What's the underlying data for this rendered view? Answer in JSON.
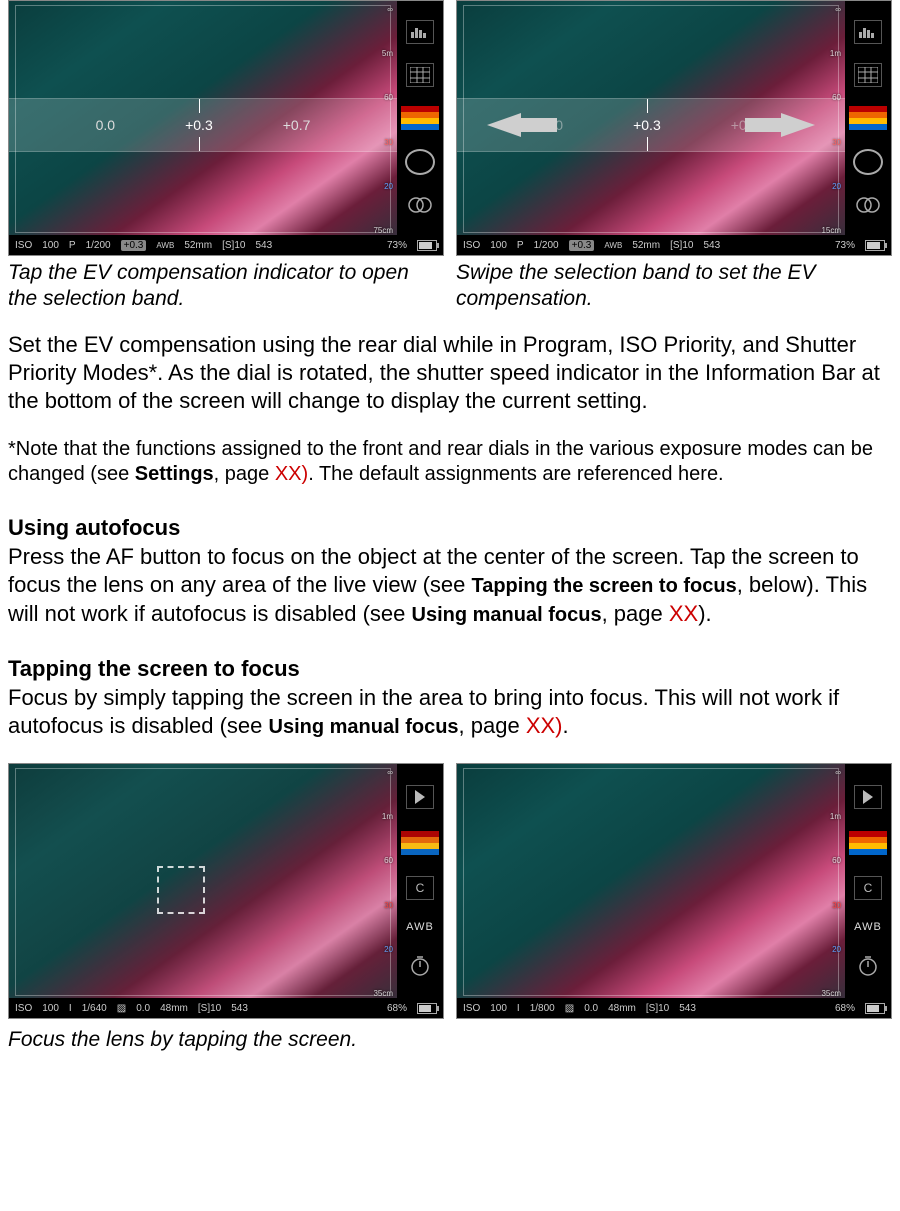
{
  "figures_top": {
    "left_caption": "Tap the EV compensation indicator to open the selection band.",
    "right_caption": "Swipe the selection band to set the EV compensation.",
    "band": {
      "left_value": "0.0",
      "center_value": "+0.3",
      "right_value": "+0.7"
    },
    "info_bar": {
      "iso_label": "ISO",
      "iso": "100",
      "mode": "P",
      "shutter": "1/200",
      "ev_box": "+0.3",
      "wb": "AWB",
      "lens": "52mm",
      "series": "[S]10",
      "frames": "543",
      "battery": "73%"
    },
    "scale": {
      "inf": "∞",
      "m5": "5m",
      "cm60": "60",
      "n30": "30",
      "n20": "20",
      "cm75": "75cm",
      "m1": "1m",
      "cm15": "15cm"
    }
  },
  "paragraph_ev": {
    "text": "Set the EV compensation using the rear dial while in Program, ISO Priority, and Shutter Priority Modes*. As the dial is rotated, the shutter speed indicator in the Information Bar at the bottom of the screen will change to display the current setting."
  },
  "note": {
    "pre": "*Note that the functions assigned to the front and rear dials in the various exposure modes can be changed (see ",
    "settings": "Settings",
    "mid": ", page ",
    "xx": "XX)",
    "post": ". The default assignments are referenced here."
  },
  "section_af": {
    "heading": "Using autofocus",
    "p_pre": "Press the AF button to focus on the object at the center of the screen. Tap the screen to focus the lens on any area of the live view (see ",
    "ref1": "Tapping the screen to focus",
    "p_mid1": ", below). This will not work if autofocus is disabled (see ",
    "ref2": "Using manual focus",
    "p_mid2": ", page ",
    "xx": "XX",
    "p_post": ")."
  },
  "section_tap": {
    "heading": "Tapping the screen to focus",
    "p_pre": "Focus by simply tapping the screen in the area to bring into focus. This will not work if autofocus is disabled (see ",
    "ref": "Using manual focus",
    "p_mid": ", page ",
    "xx": "XX)",
    "p_post": "."
  },
  "figures_bottom": {
    "caption": "Focus the lens by tapping the screen.",
    "left_info": {
      "iso_label": "ISO",
      "iso": "100",
      "mode": "I",
      "shutter": "1/640",
      "ev": "0.0",
      "lens": "48mm",
      "series": "[S]10",
      "frames": "543",
      "battery": "68%"
    },
    "right_info": {
      "iso_label": "ISO",
      "iso": "100",
      "mode": "I",
      "shutter": "1/800",
      "ev": "0.0",
      "lens": "48mm",
      "series": "[S]10",
      "frames": "543",
      "battery": "68%"
    },
    "side": {
      "awb": "AWB",
      "c": "C"
    },
    "scale": {
      "inf": "∞",
      "m1": "1m",
      "cm60": "60",
      "n30": "30",
      "n20": "20",
      "cm35": "35cm"
    }
  }
}
